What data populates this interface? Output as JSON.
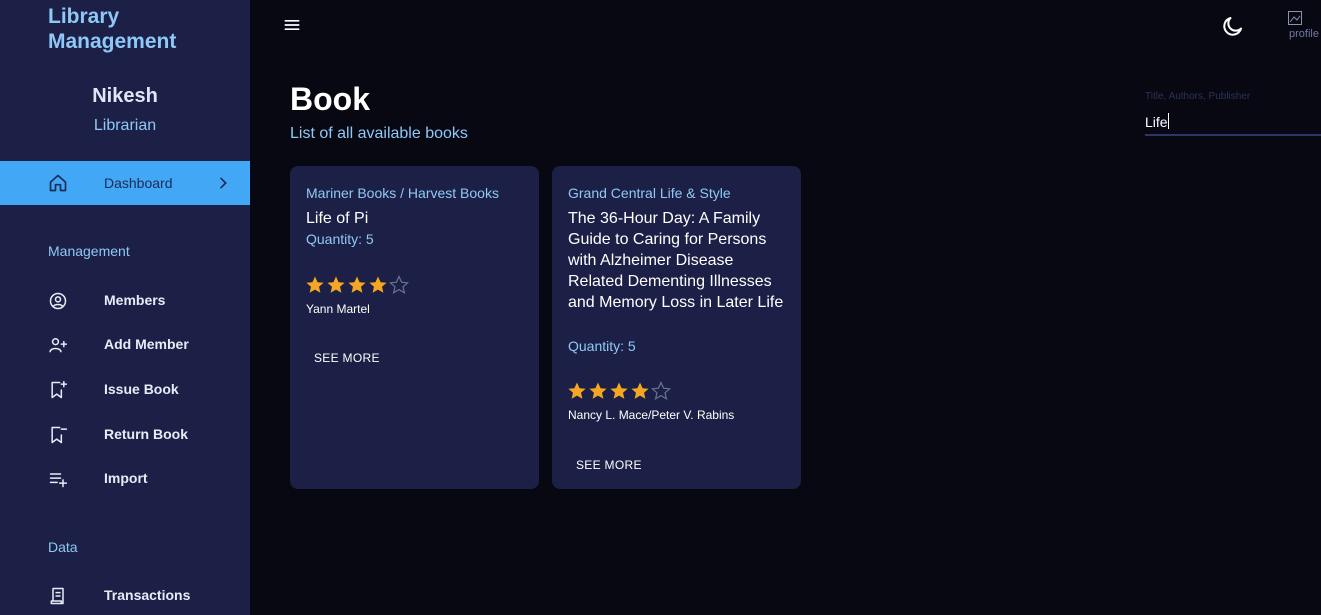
{
  "sidebar": {
    "app_title": "Library Management",
    "user": {
      "name": "Nikesh",
      "role": "Librarian"
    },
    "active_item": {
      "label": "Dashboard",
      "icon": "home-icon"
    },
    "sections": [
      {
        "title": "Management",
        "items": [
          {
            "label": "Members",
            "icon": "user-circle-icon"
          },
          {
            "label": "Add Member",
            "icon": "user-plus-icon"
          },
          {
            "label": "Issue Book",
            "icon": "bookmark-plus-icon"
          },
          {
            "label": "Return Book",
            "icon": "bookmark-minus-icon"
          },
          {
            "label": "Import",
            "icon": "playlist-add-icon"
          }
        ]
      },
      {
        "title": "Data",
        "items": [
          {
            "label": "Transactions",
            "icon": "receipt-icon"
          }
        ]
      }
    ]
  },
  "topbar": {
    "menu_icon": "menu-icon",
    "theme_icon": "moon-icon",
    "avatar_alt": "profile"
  },
  "page": {
    "title": "Book",
    "subtitle": "List of all available books"
  },
  "search": {
    "placeholder": "Title, Authors, Publisher",
    "value": "Life"
  },
  "books": [
    {
      "publisher": "Mariner Books / Harvest Books",
      "title": "Life of Pi",
      "quantity": "Quantity: 5",
      "rating": 4,
      "authors": "Yann Martel",
      "action": "SEE MORE"
    },
    {
      "publisher": "Grand Central Life & Style",
      "title": "The 36-Hour Day: A Family Guide to Caring for Persons with Alzheimer Disease Related Dementing Illnesses and Memory Loss in Later Life",
      "quantity": "Quantity: 5",
      "rating": 4,
      "authors": "Nancy L. Mace/Peter V. Rabins",
      "action": "SEE MORE"
    }
  ],
  "colors": {
    "background": "#070812",
    "sidebar": "#1c2046",
    "accent": "#42a8f5",
    "link_blue": "#8fc8f6",
    "star": "#f5a623"
  }
}
